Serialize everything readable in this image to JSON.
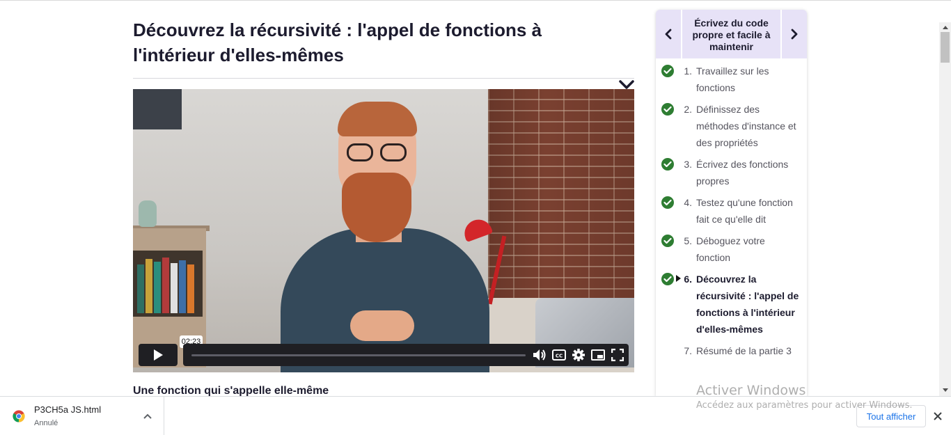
{
  "main": {
    "title": "Découvrez la récursivité : l'appel de fonctions à l'intérieur d'elles-mêmes",
    "subheading": "Une fonction qui s'appelle elle-même"
  },
  "video": {
    "time_tooltip": "02:23",
    "progress_fraction": 0.0,
    "controls": [
      "play-icon",
      "volume-icon",
      "captions-icon",
      "settings-icon",
      "picture-in-picture-icon",
      "fullscreen-icon"
    ]
  },
  "course_panel": {
    "title": "Écrivez du code propre et facile à maintenir",
    "items": [
      {
        "num": "1.",
        "label": "Travaillez sur les fonctions",
        "done": true,
        "active": false
      },
      {
        "num": "2.",
        "label": "Définissez des méthodes d'instance et des propriétés",
        "done": true,
        "active": false
      },
      {
        "num": "3.",
        "label": "Écrivez des fonctions propres",
        "done": true,
        "active": false
      },
      {
        "num": "4.",
        "label": "Testez qu'une fonction fait ce qu'elle dit",
        "done": true,
        "active": false
      },
      {
        "num": "5.",
        "label": "Déboguez votre fonction",
        "done": true,
        "active": false
      },
      {
        "num": "6.",
        "label": "Découvrez la récursivité : l'appel de fonctions à l'intérieur d'elles-mêmes",
        "done": true,
        "active": true
      },
      {
        "num": "7.",
        "label": "Résumé de la partie 3",
        "done": false,
        "active": false
      }
    ]
  },
  "watermark": {
    "title": "Activer Windows",
    "subtitle": "Accédez aux paramètres pour activer Windows."
  },
  "downloads": {
    "file_name": "P3CH5a JS.html",
    "status": "Annulé",
    "show_all_label": "Tout afficher"
  },
  "colors": {
    "accent_panel": "#e7e2f7",
    "check_green": "#2e7d32",
    "link_blue": "#1a73e8"
  }
}
